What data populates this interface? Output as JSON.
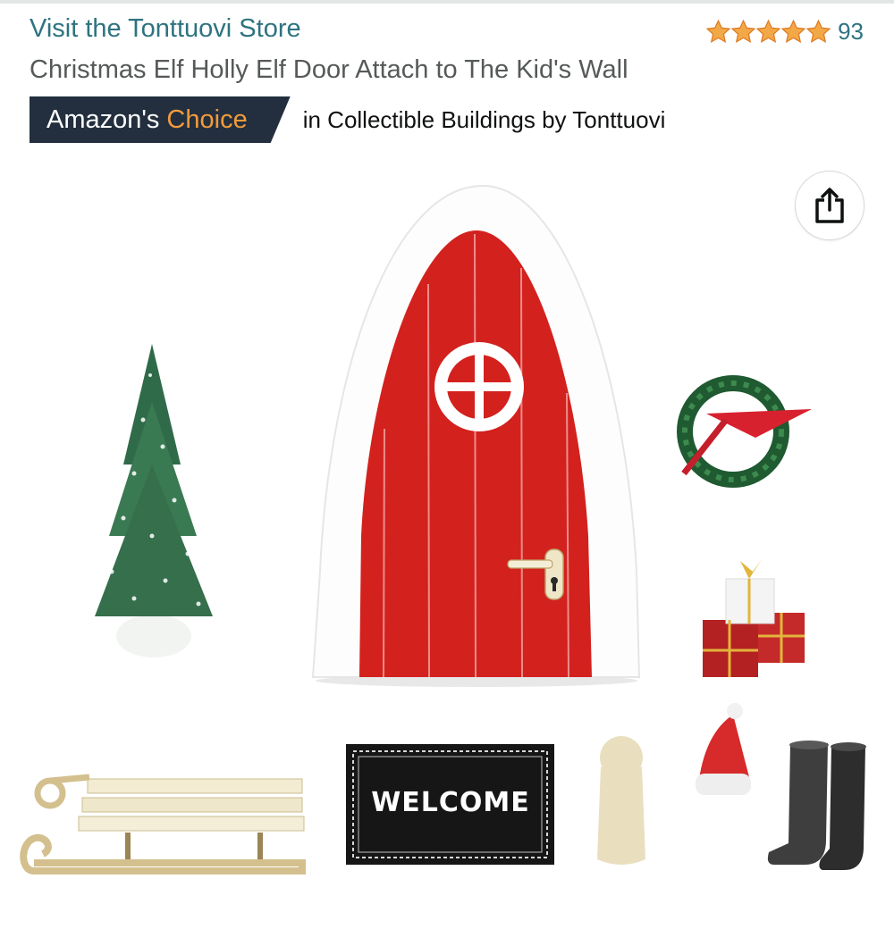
{
  "store": {
    "link_text": "Visit the Tonttuovi Store"
  },
  "rating": {
    "stars": 5,
    "count": "93",
    "star_color": "#f3a847"
  },
  "product": {
    "title": "Christmas Elf Holly Elf Door Attach to The Kid's Wall"
  },
  "badge": {
    "label_part1": "Amazon's",
    "label_part2": "Choice",
    "category_text": "in Collectible Buildings by Tonttuovi"
  },
  "image": {
    "doormat_text": "WELCOME"
  },
  "colors": {
    "link": "#2e7380",
    "badge_bg": "#232f3e",
    "badge_accent": "#f29b3b",
    "door_red": "#d3211e"
  },
  "icons": {
    "share": "share-icon",
    "star": "star-icon"
  }
}
